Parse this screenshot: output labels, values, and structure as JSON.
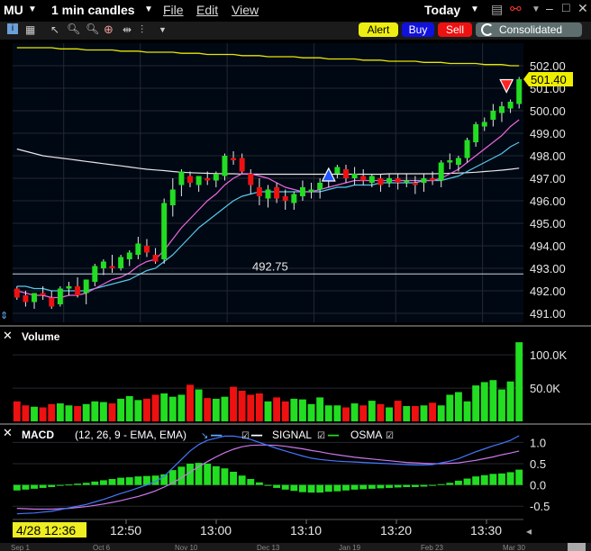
{
  "title_bar": {
    "symbol": "MU",
    "interval": "1 min candles",
    "menu": [
      "File",
      "Edit",
      "View"
    ],
    "range": "Today"
  },
  "toolbar": {
    "alert": "Alert",
    "buy": "Buy",
    "sell": "Sell",
    "consolidated": "Consolidated"
  },
  "price_panel": {
    "last_price": "501.40",
    "hline_label": "492.75",
    "ticks": [
      "502.00",
      "501.00",
      "500.00",
      "499.00",
      "498.00",
      "497.00",
      "496.00",
      "495.00",
      "494.00",
      "493.00",
      "492.00",
      "491.00"
    ]
  },
  "volume_panel": {
    "title": "Volume",
    "ticks": [
      "100.0K",
      "50.0K"
    ]
  },
  "macd_panel": {
    "title": "MACD",
    "params": "(12, 26, 9 - EMA, EMA)",
    "signal_label": "SIGNAL",
    "osma_label": "OSMA",
    "ticks": [
      "1.0",
      "0.5",
      "0.0",
      "-0.5"
    ]
  },
  "time_axis": {
    "cursor_label": "4/28 12:36",
    "ticks": [
      "12:50",
      "13:00",
      "13:10",
      "13:20",
      "13:30"
    ],
    "date_strip": [
      "Sep 1",
      "Oct 6",
      "Nov 10",
      "Dec 13",
      "Jan 19",
      "Feb 23",
      "Mar 30"
    ]
  },
  "colors": {
    "up": "#22dd22",
    "down": "#ee1111",
    "bg": "#000814",
    "panel": "#000000",
    "grid": "#242830",
    "yellow": "#eeee00",
    "alert": "#eeee11",
    "buy": "#1111dd",
    "sell": "#ee1111"
  },
  "chart_data": {
    "type": "candlestick",
    "candles": [
      [
        492.1,
        492.2,
        491.6,
        491.7
      ],
      [
        491.8,
        492.0,
        491.3,
        491.5
      ],
      [
        491.5,
        491.9,
        491.2,
        491.9
      ],
      [
        491.9,
        492.2,
        491.6,
        491.8
      ],
      [
        491.7,
        492.0,
        491.2,
        491.3
      ],
      [
        491.4,
        492.2,
        491.3,
        492.1
      ],
      [
        492.1,
        492.4,
        491.8,
        492.2
      ],
      [
        492.2,
        492.6,
        491.7,
        491.8
      ],
      [
        491.9,
        492.5,
        491.4,
        492.5
      ],
      [
        492.4,
        493.2,
        492.2,
        493.1
      ],
      [
        493.0,
        493.4,
        492.7,
        493.3
      ],
      [
        493.1,
        493.6,
        492.8,
        493.0
      ],
      [
        493.0,
        493.6,
        492.9,
        493.5
      ],
      [
        493.4,
        493.8,
        493.1,
        493.7
      ],
      [
        493.6,
        494.4,
        493.4,
        494.1
      ],
      [
        494.0,
        494.3,
        493.5,
        493.7
      ],
      [
        493.6,
        493.9,
        493.2,
        493.3
      ],
      [
        493.4,
        496.1,
        493.2,
        495.9
      ],
      [
        495.8,
        497.0,
        495.3,
        496.5
      ],
      [
        496.7,
        497.4,
        496.2,
        497.3
      ],
      [
        497.1,
        497.3,
        496.6,
        496.8
      ],
      [
        496.7,
        497.1,
        496.4,
        497.1
      ],
      [
        497.0,
        497.3,
        496.7,
        496.9
      ],
      [
        496.9,
        497.3,
        496.6,
        497.2
      ],
      [
        497.1,
        498.1,
        496.9,
        498.0
      ],
      [
        497.9,
        498.2,
        497.6,
        497.8
      ],
      [
        497.9,
        498.1,
        497.2,
        497.3
      ],
      [
        497.2,
        497.4,
        496.3,
        496.7
      ],
      [
        496.6,
        497.0,
        495.8,
        496.2
      ],
      [
        496.1,
        496.7,
        495.7,
        496.5
      ],
      [
        496.6,
        496.8,
        495.9,
        496.1
      ],
      [
        496.2,
        496.5,
        495.6,
        496.0
      ],
      [
        495.9,
        496.4,
        495.6,
        496.3
      ],
      [
        496.2,
        496.9,
        496.0,
        496.6
      ],
      [
        496.4,
        496.8,
        496.1,
        496.5
      ],
      [
        496.5,
        497.0,
        496.1,
        496.8
      ],
      [
        496.9,
        497.4,
        496.6,
        497.3
      ],
      [
        497.2,
        497.6,
        497.0,
        497.5
      ],
      [
        497.4,
        497.6,
        496.8,
        497.0
      ],
      [
        497.0,
        497.5,
        496.7,
        497.2
      ],
      [
        497.1,
        497.4,
        496.7,
        496.9
      ],
      [
        496.8,
        497.2,
        496.6,
        497.1
      ],
      [
        497.0,
        497.2,
        496.4,
        496.7
      ],
      [
        496.8,
        497.2,
        496.6,
        497.0
      ],
      [
        497.0,
        497.2,
        496.5,
        496.8
      ],
      [
        496.8,
        497.2,
        496.6,
        496.9
      ],
      [
        496.8,
        497.1,
        496.3,
        496.7
      ],
      [
        496.8,
        497.2,
        496.4,
        497.0
      ],
      [
        497.0,
        497.3,
        496.7,
        496.9
      ],
      [
        496.9,
        497.8,
        496.6,
        497.7
      ],
      [
        497.7,
        498.1,
        497.4,
        497.8
      ],
      [
        497.6,
        498.0,
        497.3,
        497.9
      ],
      [
        497.9,
        498.8,
        497.7,
        498.7
      ],
      [
        498.6,
        499.5,
        498.4,
        499.4
      ],
      [
        499.3,
        499.7,
        499.1,
        499.5
      ],
      [
        499.6,
        500.3,
        499.3,
        500.0
      ],
      [
        499.9,
        500.4,
        499.5,
        500.2
      ],
      [
        500.1,
        500.5,
        499.9,
        500.4
      ],
      [
        500.3,
        501.5,
        500.1,
        501.4
      ]
    ],
    "volume": [
      30,
      24,
      22,
      21,
      26,
      27,
      24,
      23,
      26,
      30,
      29,
      27,
      34,
      38,
      32,
      34,
      40,
      42,
      37,
      40,
      55,
      48,
      35,
      34,
      37,
      52,
      46,
      40,
      42,
      30,
      36,
      30,
      34,
      33,
      26,
      36,
      24,
      24,
      21,
      27,
      24,
      31,
      26,
      21,
      31,
      23,
      23,
      24,
      28,
      24,
      40,
      44,
      30,
      54,
      59,
      62,
      48,
      60,
      119
    ],
    "macd": [
      -0.68,
      -0.67,
      -0.66,
      -0.64,
      -0.62,
      -0.58,
      -0.54,
      -0.5,
      -0.46,
      -0.4,
      -0.34,
      -0.27,
      -0.2,
      -0.14,
      -0.07,
      0.0,
      0.08,
      0.2,
      0.4,
      0.6,
      0.8,
      0.95,
      1.05,
      1.1,
      1.15,
      1.15,
      1.12,
      1.07,
      1.0,
      0.93,
      0.86,
      0.8,
      0.74,
      0.68,
      0.63,
      0.6,
      0.58,
      0.56,
      0.55,
      0.54,
      0.53,
      0.52,
      0.51,
      0.5,
      0.49,
      0.48,
      0.47,
      0.47,
      0.48,
      0.52,
      0.56,
      0.62,
      0.7,
      0.78,
      0.85,
      0.92,
      0.98,
      1.05,
      1.16
    ],
    "signal": [
      -0.55,
      -0.56,
      -0.57,
      -0.57,
      -0.57,
      -0.56,
      -0.55,
      -0.53,
      -0.51,
      -0.48,
      -0.45,
      -0.41,
      -0.37,
      -0.32,
      -0.27,
      -0.21,
      -0.14,
      -0.05,
      0.05,
      0.17,
      0.3,
      0.43,
      0.55,
      0.66,
      0.76,
      0.84,
      0.9,
      0.93,
      0.94,
      0.94,
      0.93,
      0.91,
      0.88,
      0.85,
      0.81,
      0.78,
      0.74,
      0.71,
      0.68,
      0.65,
      0.63,
      0.61,
      0.59,
      0.57,
      0.55,
      0.53,
      0.52,
      0.51,
      0.5,
      0.5,
      0.51,
      0.52,
      0.55,
      0.58,
      0.62,
      0.66,
      0.71,
      0.75,
      0.8
    ],
    "osma": [
      -0.13,
      -0.11,
      -0.09,
      -0.07,
      -0.05,
      -0.02,
      0.01,
      0.03,
      0.05,
      0.08,
      0.11,
      0.14,
      0.17,
      0.18,
      0.2,
      0.21,
      0.22,
      0.25,
      0.35,
      0.43,
      0.5,
      0.52,
      0.5,
      0.44,
      0.39,
      0.31,
      0.22,
      0.14,
      0.06,
      -0.01,
      -0.07,
      -0.11,
      -0.14,
      -0.17,
      -0.18,
      -0.18,
      -0.16,
      -0.15,
      -0.13,
      -0.11,
      -0.1,
      -0.09,
      -0.08,
      -0.07,
      -0.06,
      -0.05,
      -0.05,
      -0.04,
      -0.02,
      0.02,
      0.05,
      0.1,
      0.15,
      0.2,
      0.23,
      0.26,
      0.27,
      0.3,
      0.36
    ],
    "ema_fast": [
      492.0,
      491.9,
      491.8,
      491.8,
      491.7,
      491.7,
      491.8,
      491.8,
      491.9,
      492.1,
      492.3,
      492.5,
      492.6,
      492.8,
      493.1,
      493.3,
      493.4,
      493.8,
      494.3,
      494.8,
      495.2,
      495.6,
      496.0,
      496.3,
      496.7,
      497.0,
      497.2,
      497.2,
      497.1,
      497.0,
      496.8,
      496.6,
      496.5,
      496.4,
      496.4,
      496.5,
      496.6,
      496.7,
      496.8,
      496.9,
      496.9,
      496.9,
      496.9,
      496.9,
      496.9,
      496.9,
      496.9,
      496.9,
      496.9,
      497.0,
      497.2,
      497.4,
      497.7,
      498.0,
      498.3,
      498.6,
      498.9,
      499.3,
      499.6
    ],
    "ema_slow": [
      492.2,
      492.2,
      492.1,
      492.1,
      492.0,
      492.0,
      492.0,
      492.0,
      492.0,
      492.1,
      492.2,
      492.3,
      492.4,
      492.5,
      492.7,
      492.9,
      493.0,
      493.3,
      493.6,
      494.0,
      494.4,
      494.8,
      495.1,
      495.4,
      495.7,
      496.0,
      496.2,
      496.3,
      496.4,
      496.4,
      496.4,
      496.4,
      496.4,
      496.4,
      496.4,
      496.4,
      496.5,
      496.6,
      496.6,
      496.7,
      496.7,
      496.7,
      496.8,
      496.8,
      496.8,
      496.8,
      496.8,
      496.9,
      496.9,
      496.9,
      497.0,
      497.1,
      497.3,
      497.5,
      497.7,
      497.9,
      498.1,
      498.4,
      498.6
    ],
    "sma_long": [
      498.3,
      498.2,
      498.1,
      498.0,
      497.95,
      497.9,
      497.85,
      497.8,
      497.75,
      497.7,
      497.65,
      497.6,
      497.55,
      497.5,
      497.45,
      497.4,
      497.37,
      497.34,
      497.3,
      497.27,
      497.25,
      497.23,
      497.22,
      497.21,
      497.2,
      497.2,
      497.19,
      497.19,
      497.18,
      497.18,
      497.18,
      497.18,
      497.18,
      497.18,
      497.18,
      497.18,
      497.18,
      497.18,
      497.18,
      497.18,
      497.18,
      497.18,
      497.18,
      497.2,
      497.2,
      497.2,
      497.2,
      497.2,
      497.2,
      497.21,
      497.22,
      497.23,
      497.25,
      497.27,
      497.3,
      497.33,
      497.36,
      497.4,
      497.45
    ],
    "yellow_line": [
      502.8,
      502.8,
      502.8,
      502.8,
      502.8,
      502.75,
      502.75,
      502.75,
      502.7,
      502.7,
      502.7,
      502.7,
      502.65,
      502.65,
      502.65,
      502.6,
      502.6,
      502.6,
      502.6,
      502.55,
      502.55,
      502.55,
      502.5,
      502.5,
      502.5,
      502.5,
      502.45,
      502.45,
      502.45,
      502.4,
      502.4,
      502.4,
      502.4,
      502.35,
      502.35,
      502.35,
      502.3,
      502.3,
      502.3,
      502.3,
      502.25,
      502.25,
      502.25,
      502.2,
      502.2,
      502.2,
      502.2,
      502.15,
      502.15,
      502.15,
      502.1,
      502.1,
      502.1,
      502.1,
      502.05,
      502.05,
      502.05,
      502.0,
      502.0
    ],
    "hline": 492.75,
    "buy_marker_index": 36,
    "sell_marker_index": 58,
    "price_range": [
      490.6,
      503.0
    ],
    "volume_max": 130,
    "macd_range": [
      -0.75,
      1.2
    ]
  }
}
